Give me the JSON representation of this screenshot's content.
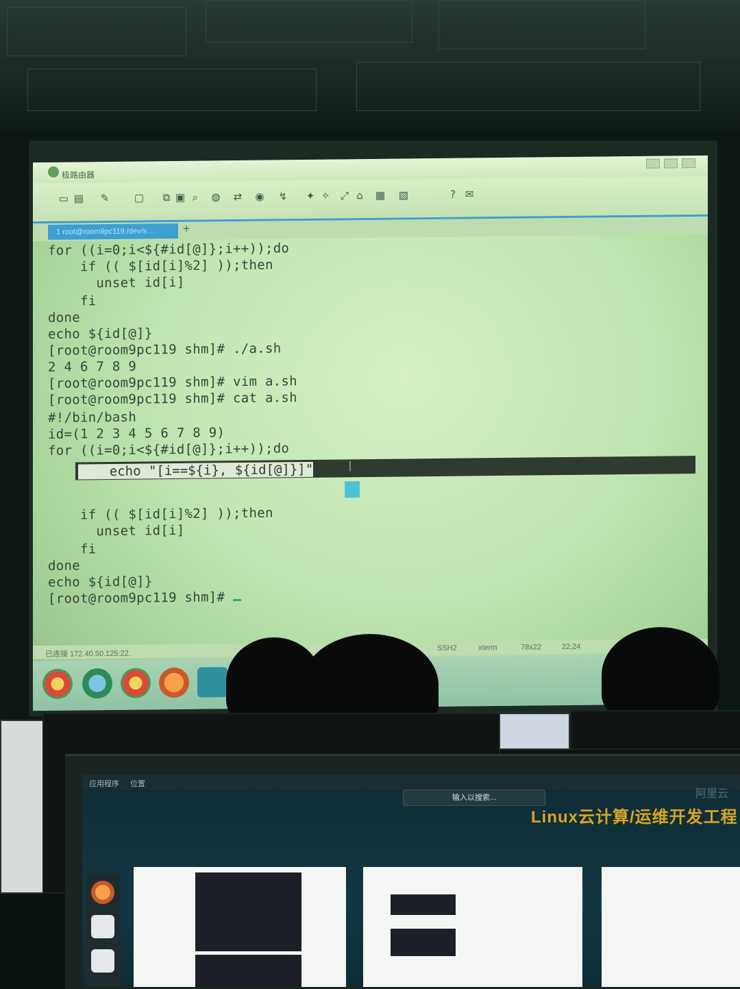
{
  "app": {
    "title": "极路由器",
    "tab_label": "1 root@room9pc119:/dev/s..."
  },
  "terminal_lines": [
    "for ((i=0;i<${#id[@]};i++));do",
    "    if (( $[id[i]%2] ));then",
    "      unset id[i]",
    "    fi",
    "done",
    "echo ${id[@]}",
    "[root@room9pc119 shm]# ./a.sh",
    "2 4 6 7 8 9",
    "[root@room9pc119 shm]# vim a.sh",
    "[root@room9pc119 shm]# cat a.sh",
    "#!/bin/bash",
    "id=(1 2 3 4 5 6 7 8 9)",
    "for ((i=0;i<${#id[@]};i++));do",
    "",
    "    echo \"[i==${i}, ${id[@]}]\"",
    "",
    "    if (( $[id[i]%2] ));then",
    "      unset id[i]",
    "    fi",
    "done",
    "echo ${id[@]}",
    "[root@room9pc119 shm]#"
  ],
  "status": {
    "connection": "已连接 172.40.50.125:22.",
    "protocol": "SSH2",
    "term": "xterm",
    "size": "78x22",
    "position": "22,24"
  },
  "desktop": {
    "menu_apps": "应用程序",
    "menu_places": "位置",
    "search_placeholder": "输入以搜索...",
    "brand_text": "Linux云计算/运维开发工程",
    "brand_logo_text": "阿里云"
  },
  "colors": {
    "projection_bg": "#c8e9b8",
    "terminal_text": "#36453a",
    "highlight_bar": "#2f3a30",
    "tab_blue": "#3d9fd2",
    "brand_gold": "#d9a623"
  }
}
